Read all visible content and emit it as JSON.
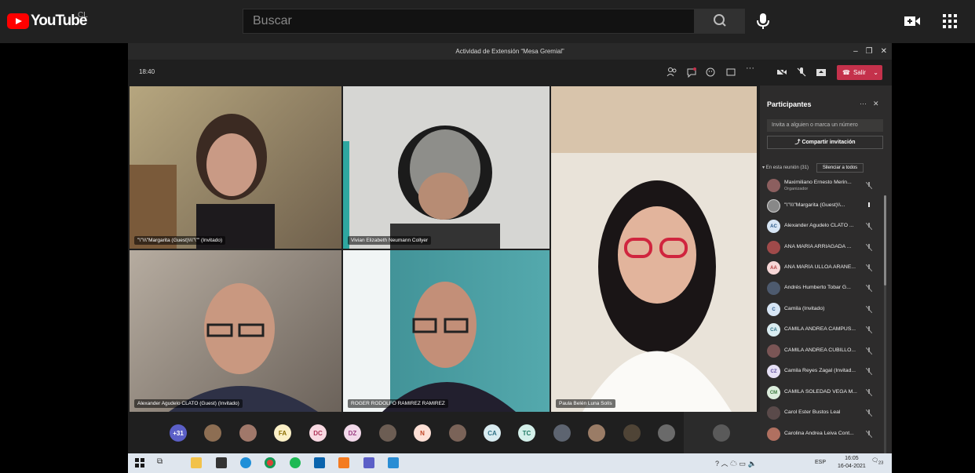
{
  "youtube": {
    "logo_text": "YouTube",
    "country": "CL",
    "search_placeholder": "Buscar"
  },
  "teams": {
    "window_title": "Actividad de Extensión “Mesa Gremial”",
    "call_time": "18:40",
    "leave_label": "Salir",
    "tiles": [
      {
        "name": "\"\\\"\\\\\\\"Margarita (Guest)\\\\\\\"\\\"\" (Invitado)",
        "bg": "#8a7b5a"
      },
      {
        "name": "Vivian Elizabeth Neumann Collyer",
        "bg": "#c9cbc8"
      },
      {
        "name": "Paula Belén Luna Solís",
        "bg": "#e6ddd0"
      },
      {
        "name": "Alexander Agudelo CLATO (Guest) (Invitado)",
        "bg": "#8e8276"
      },
      {
        "name": "ROGER RODOLFO RAMIREZ RAMIREZ",
        "bg": "#3e8a8c"
      }
    ],
    "strip": [
      {
        "label": "+31",
        "bg": "#5b5fc7",
        "fg": "#fff"
      },
      {
        "label": "",
        "bg": "#8d6e53",
        "fg": "#fff"
      },
      {
        "label": "",
        "bg": "#a0786a",
        "fg": "#fff"
      },
      {
        "label": "FA",
        "bg": "#fbf0c7",
        "fg": "#8a6d00"
      },
      {
        "label": "DC",
        "bg": "#f9d9e2",
        "fg": "#b0355a"
      },
      {
        "label": "DZ",
        "bg": "#f2d9ea",
        "fg": "#9b3d82"
      },
      {
        "label": "",
        "bg": "#6c5d53",
        "fg": "#fff"
      },
      {
        "label": "N",
        "bg": "#fde0d6",
        "fg": "#c2492a"
      },
      {
        "label": "",
        "bg": "#7a6358",
        "fg": "#fff"
      },
      {
        "label": "CA",
        "bg": "#d9ecf1",
        "fg": "#2f7185"
      },
      {
        "label": "TC",
        "bg": "#d4f0ea",
        "fg": "#207a64"
      },
      {
        "label": "",
        "bg": "#5d6470",
        "fg": "#fff"
      },
      {
        "label": "",
        "bg": "#9a7c66",
        "fg": "#fff"
      },
      {
        "label": "",
        "bg": "#4f4436",
        "fg": "#fff"
      },
      {
        "label": "",
        "bg": "#6a6a6a",
        "fg": "#fff"
      }
    ],
    "participants": {
      "title": "Participantes",
      "invite_placeholder": "Invita a alguien o marca un número",
      "share_label": "Compartir invitación",
      "section_label": "En esta reunión (31)",
      "mute_all": "Silenciar a todos",
      "list": [
        {
          "name": "Maximiliano Ernesto Merin...",
          "sub": "Organizador",
          "initials": "",
          "bg": "#8c5f5f"
        },
        {
          "name": "\"\\\"\\\\\\\"Margarita (Guest)\\\\...",
          "sub": "",
          "initials": "",
          "bg": "#888"
        },
        {
          "name": "Alexander Agudelo CLATO ...",
          "sub": "",
          "initials": "AC",
          "bg": "#d7e6f5"
        },
        {
          "name": "ANA MARÍA ARRIAGADA ...",
          "sub": "",
          "initials": "",
          "bg": "#a04a4a"
        },
        {
          "name": "ANA MARÍA ULLOA ARANE...",
          "sub": "",
          "initials": "AA",
          "bg": "#f7d7d7"
        },
        {
          "name": "Andrés Humberto Tobar G...",
          "sub": "",
          "initials": "",
          "bg": "#4d5a6e"
        },
        {
          "name": "Camila (Invitado)",
          "sub": "",
          "initials": "C",
          "bg": "#d7e6f5"
        },
        {
          "name": "CAMILA ANDREA CAMPUS...",
          "sub": "",
          "initials": "CA",
          "bg": "#d9ecf1"
        },
        {
          "name": "CAMILA ANDREA CUBILLO...",
          "sub": "",
          "initials": "",
          "bg": "#7a5555"
        },
        {
          "name": "Camila Reyes Zagal (Invitad...",
          "sub": "",
          "initials": "CZ",
          "bg": "#e6e0f5"
        },
        {
          "name": "CAMILA SOLEDAD VEGA M...",
          "sub": "",
          "initials": "CM",
          "bg": "#dceedd"
        },
        {
          "name": "Carol Ester Bustos Leal",
          "sub": "",
          "initials": "",
          "bg": "#5a4a4a"
        },
        {
          "name": "Carolina Andrea Leiva Cont...",
          "sub": "",
          "initials": "",
          "bg": "#b07060"
        }
      ]
    }
  },
  "taskbar": {
    "lang": "ESP",
    "time": "16:05",
    "date": "16-04-2021",
    "notif": "23"
  }
}
